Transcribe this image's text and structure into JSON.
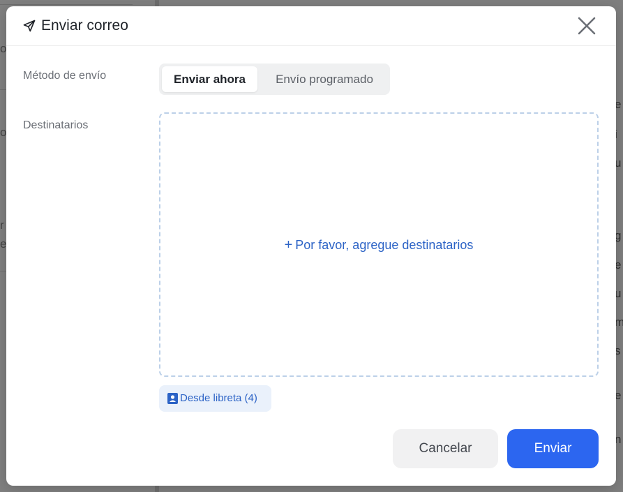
{
  "modal": {
    "title": "Enviar correo",
    "fields": {
      "method_label": "Método de envío",
      "recipients_label": "Destinatarios"
    },
    "send_method": {
      "options": [
        "Enviar ahora",
        "Envío programado"
      ],
      "selected": "Enviar ahora"
    },
    "recipients": {
      "placeholder": "Por favor, agregue destinatarios",
      "address_book": "Desde libreta (4)"
    },
    "buttons": {
      "cancel": "Cancelar",
      "send": "Enviar"
    }
  },
  "icons": {
    "title": "send-icon",
    "close": "close-icon",
    "add": "plus-icon",
    "address_book": "contact-book-icon"
  },
  "colors": {
    "accent": "#2c66f0",
    "link": "#2c63c6",
    "dashed_border": "#bcd0e8"
  }
}
